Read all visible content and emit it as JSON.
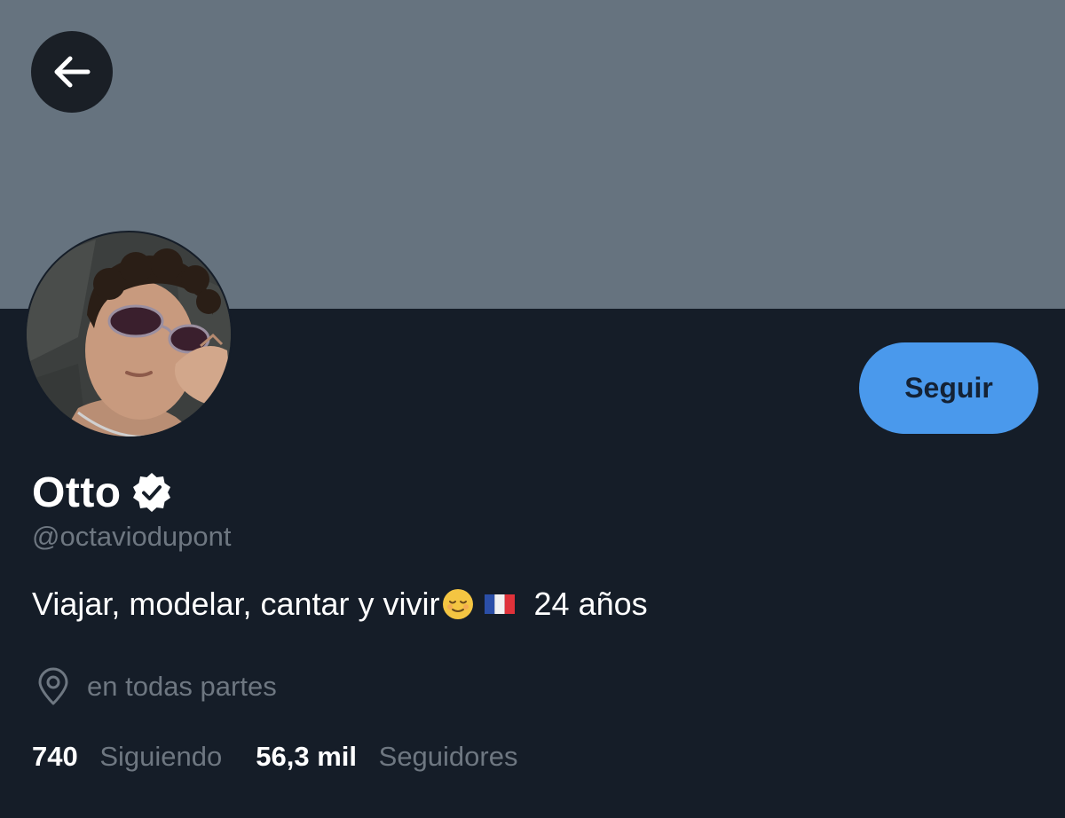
{
  "header": {
    "banner_color": "#66737f",
    "back_icon": "arrow-left-icon"
  },
  "profile": {
    "avatar_icon": "profile-photo",
    "display_name": "Otto",
    "verified_icon": "verified-badge-icon",
    "handle": "@octaviodupont",
    "bio_text": "Viajar, modelar, cantar y vivir",
    "bio_emoji": "relieved-face-emoji",
    "bio_flag": "france-flag-emoji",
    "bio_age": "24 años",
    "location_icon": "location-pin-icon",
    "location": "en todas partes"
  },
  "actions": {
    "follow_label": "Seguir",
    "follow_color": "#4a99ec"
  },
  "stats": {
    "following_count": "740",
    "following_label": "Siguiendo",
    "followers_count": "56,3 mil",
    "followers_label": "Seguidores"
  },
  "colors": {
    "background": "#151d28",
    "muted_text": "#6e7781",
    "primary_text": "#ffffff"
  }
}
